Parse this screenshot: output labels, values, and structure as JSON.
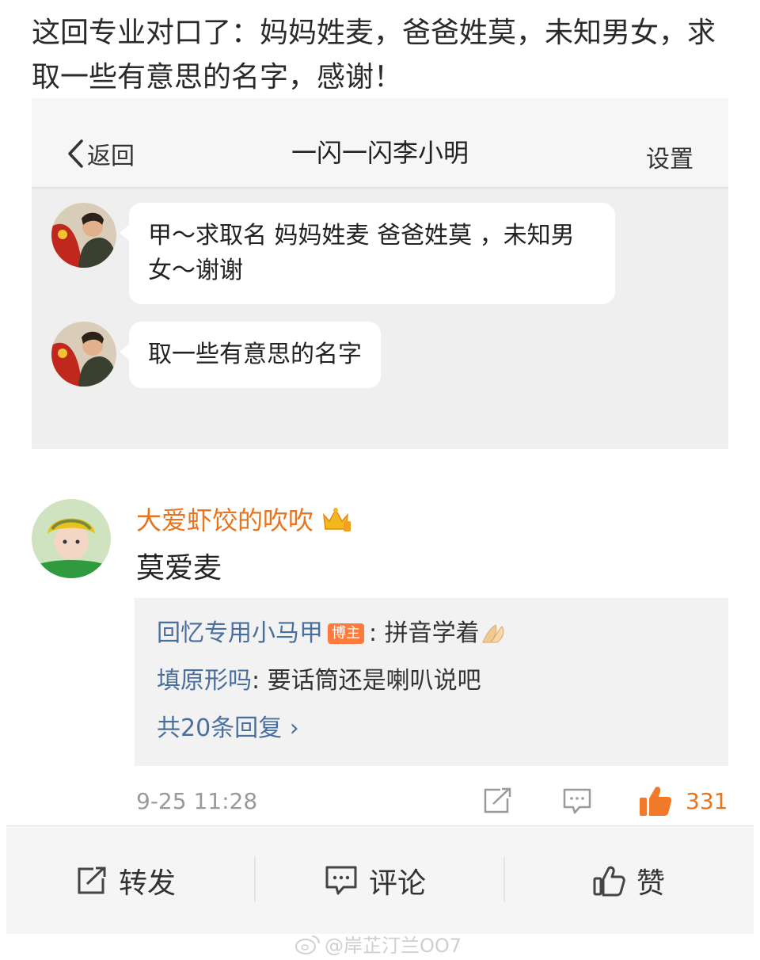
{
  "post": {
    "text": "这回专业对口了：妈妈姓麦，爸爸姓莫，未知男女，求取一些有意思的名字，感谢！"
  },
  "chat": {
    "back_label": "返回",
    "title": "一闪一闪李小明",
    "settings_label": "设置",
    "messages": [
      {
        "text": "甲～求取名 妈妈姓麦 爸爸姓莫 ，未知男女～谢谢"
      },
      {
        "text": "取一些有意思的名字"
      }
    ]
  },
  "comment": {
    "author": "大爱虾饺的吹吹",
    "body": "莫爱麦",
    "replies": [
      {
        "user": "回忆专用小马甲",
        "badge": "博主",
        "text": ": 拼音学着"
      },
      {
        "user": "填原形吗",
        "text": ": 要话筒还是喇叭说吧"
      }
    ],
    "more_replies": "共20条回复 ›",
    "time": "9-25 11:28",
    "like_count": "331"
  },
  "footer": {
    "repost_label": "转发",
    "comment_label": "评论",
    "like_label": "赞"
  },
  "watermark": "@岸芷汀兰OO7",
  "colors": {
    "accent": "#e8741e",
    "link": "#4a6f9c",
    "badge": "#ff7a3d"
  }
}
